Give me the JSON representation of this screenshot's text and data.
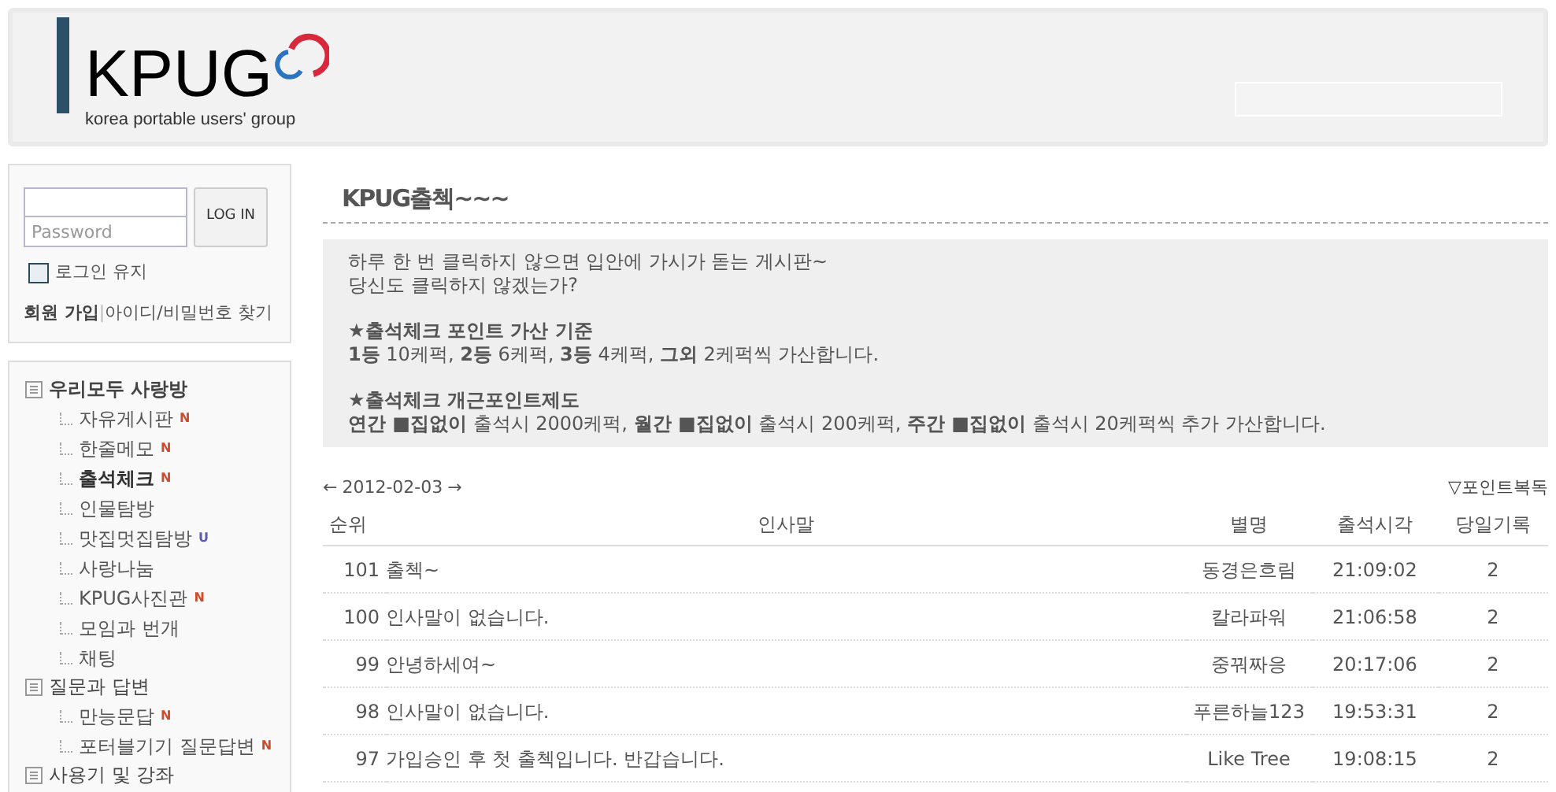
{
  "header": {
    "logo": "KPUG",
    "tagline": "korea portable users' group"
  },
  "login": {
    "password_placeholder": "Password",
    "button": "LOG IN",
    "remember": {
      "label": "로그인 유지",
      "checked": false
    },
    "join": "회원 가입",
    "separator": "|",
    "find": "아이디/비밀번호 찾기"
  },
  "sidebar": {
    "items": [
      {
        "label": "우리모두 사랑방",
        "bold": true,
        "children": [
          {
            "label": "자유게시판",
            "badge": "N",
            "selected": false
          },
          {
            "label": "한줄메모",
            "badge": "N",
            "selected": false
          },
          {
            "label": "출석체크",
            "badge": "N",
            "selected": true
          },
          {
            "label": "인물탐방",
            "selected": false
          },
          {
            "label": "맛집멋집탐방",
            "badge": "U",
            "selected": false
          },
          {
            "label": "사랑나눔",
            "selected": false
          },
          {
            "label": "KPUG사진관",
            "badge": "N",
            "selected": false
          },
          {
            "label": "모임과 번개",
            "selected": false
          },
          {
            "label": "채팅",
            "selected": false
          }
        ]
      },
      {
        "label": "질문과 답변",
        "bold": false,
        "children": [
          {
            "label": "만능문답",
            "badge": "N",
            "selected": false
          },
          {
            "label": "포터블기기 질문답변",
            "badge": "N",
            "selected": false
          }
        ]
      },
      {
        "label": "사용기 및 강좌",
        "bold": false
      }
    ]
  },
  "board": {
    "title": "KPUG출첵~~~",
    "notice": [
      [
        "하루 한 번 클릭하지 않으면 입안에 가시가 돋는 게시판~",
        "당신도 클릭하지 않겠는가?"
      ],
      [
        "**★출석체크 포인트 가산 기준**",
        "**1등** 10케퍽, **2등** 6케퍽, **3등** 4케퍽, **그외** 2케퍽씩 가산합니다."
      ],
      [
        "**★출석체크 개근포인트제도**",
        "**연간 ■집없이** 출석시 2000케퍽, **월간 ■집없이** 출석시 200케퍽, **주간 ■집없이** 출석시 20케퍽씩 추가 가산합니다."
      ]
    ],
    "prev": "←",
    "date": "2012-02-03",
    "next": "→",
    "point_link": "▽포인트복독",
    "table": {
      "columns": [
        "순위",
        "인사말",
        "별명",
        "출석시각",
        "당일기록"
      ],
      "rows": [
        [
          "101",
          "출첵~",
          "동경은흐림",
          "21:09:02",
          "2"
        ],
        [
          "100",
          "인사말이 없습니다.",
          "칼라파워",
          "21:06:58",
          "2"
        ],
        [
          "99",
          "안녕하세여~",
          "중꿔짜응",
          "20:17:06",
          "2"
        ],
        [
          "98",
          "인사말이 없습니다.",
          "푸른하늘123",
          "19:53:31",
          "2"
        ],
        [
          "97",
          "가입승인 후 첫 출첵입니다. 반갑습니다.",
          "Like Tree",
          "19:08:15",
          "2"
        ]
      ]
    }
  }
}
